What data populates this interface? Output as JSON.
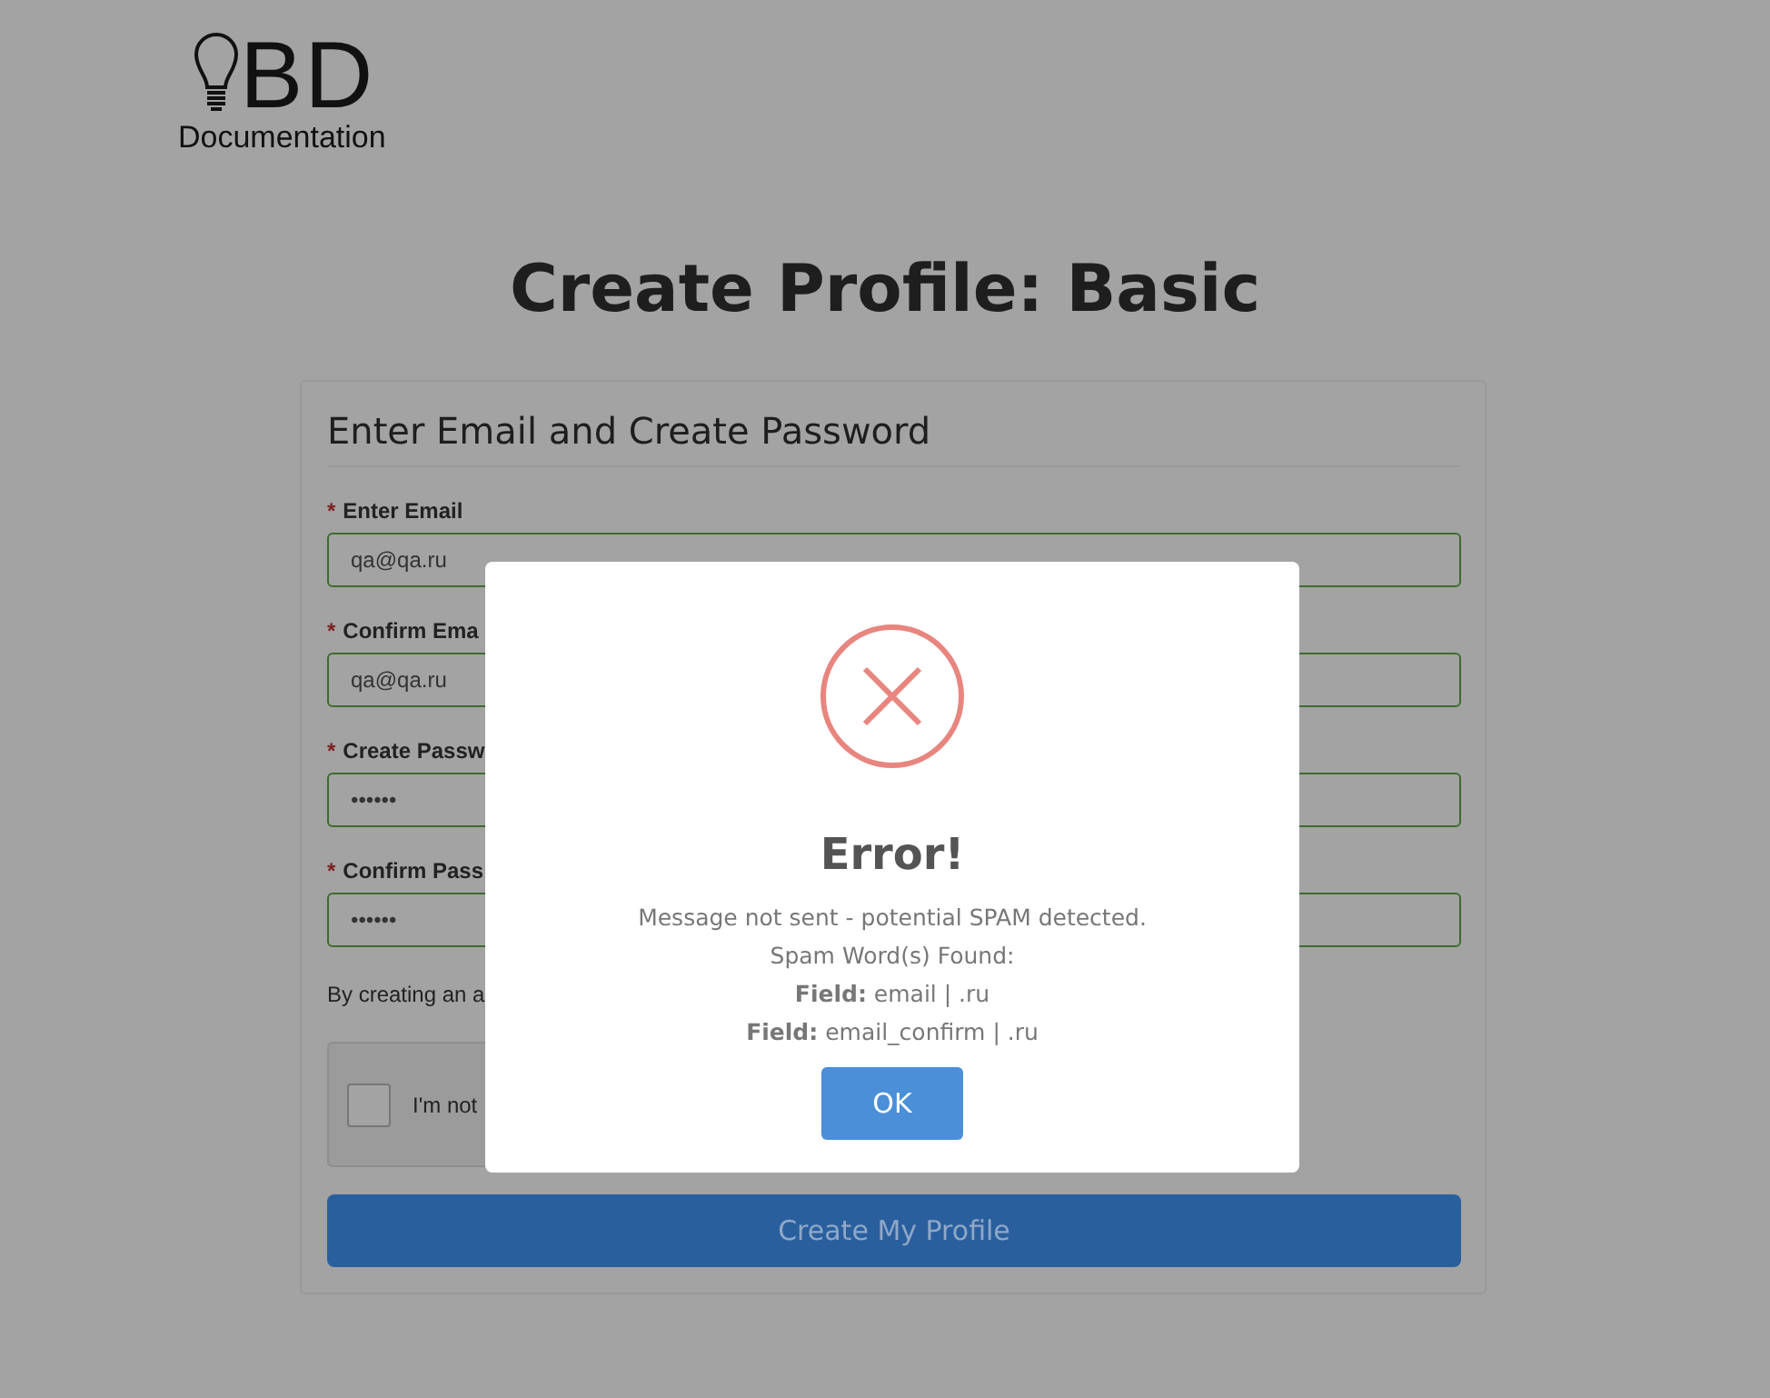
{
  "logo": {
    "mark": "BD",
    "caption": "Documentation"
  },
  "heading": "Create Profile: Basic",
  "form": {
    "title": "Enter Email and Create Password",
    "fields": [
      {
        "label": "Enter Email",
        "marker": "*",
        "value": "qa@qa.ru"
      },
      {
        "label": "Confirm Ema",
        "marker": "*",
        "value": "qa@qa.ru"
      },
      {
        "label": "Create Passw",
        "marker": "*",
        "value": "••••••"
      },
      {
        "label": "Confirm Pass",
        "marker": "*",
        "value": "••••••"
      }
    ],
    "notice": "By creating an a",
    "captcha": {
      "label": "I'm not",
      "checked": false
    },
    "submit": "Create My Profile"
  },
  "dialog": {
    "title": "Error!",
    "lines": [
      "Message not sent - potential SPAM detected.",
      "Spam Word(s) Found:",
      "**Field:** email | .ru",
      "**Field:** email_confirm | .ru"
    ],
    "button": "OK"
  }
}
